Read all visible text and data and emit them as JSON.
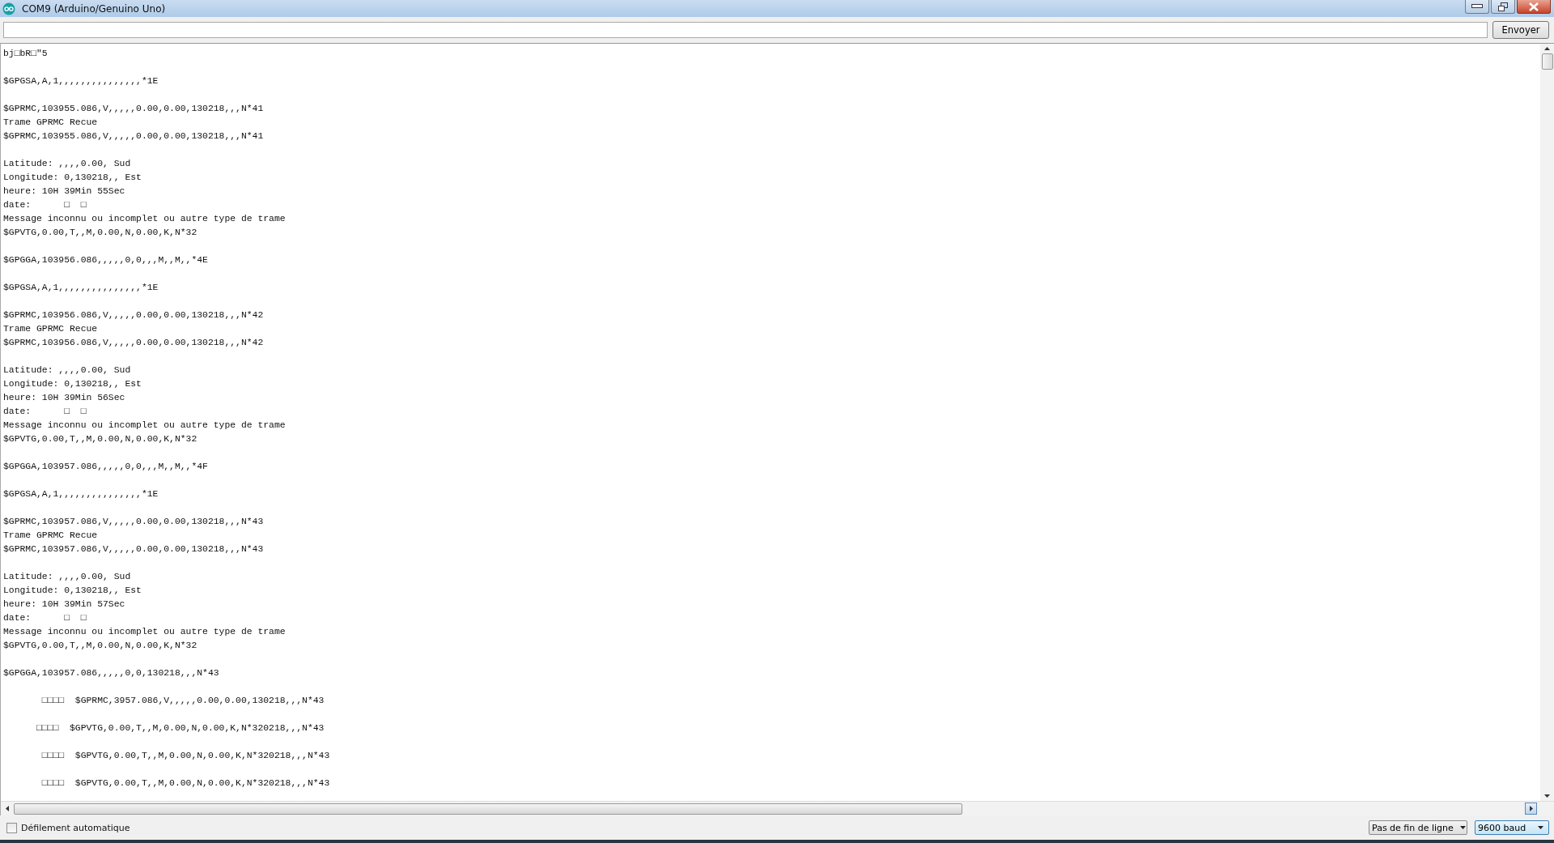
{
  "window": {
    "title": "COM9 (Arduino/Genuino Uno)"
  },
  "send_button": "Envoyer",
  "output": [
    [
      "bj□bR□\"5"
    ],
    [
      "$GPGSA,A,1,,,,,,,,,,,,,,,*1E"
    ],
    [
      "$GPRMC,103955.086,V,,,,,0.00,0.00,130218,,,N*41",
      "Trame GPRMC Recue",
      "$GPRMC,103955.086,V,,,,,0.00,0.00,130218,,,N*41"
    ],
    [
      "Latitude: ,,,,0.00, Sud",
      "Longitude: 0,130218,, Est",
      "heure: 10H 39Min 55Sec",
      "date:      □  □",
      "Message inconnu ou incomplet ou autre type de trame",
      "$GPVTG,0.00,T,,M,0.00,N,0.00,K,N*32"
    ],
    [
      "$GPGGA,103956.086,,,,,0,0,,,M,,M,,*4E"
    ],
    [
      "$GPGSA,A,1,,,,,,,,,,,,,,,*1E"
    ],
    [
      "$GPRMC,103956.086,V,,,,,0.00,0.00,130218,,,N*42",
      "Trame GPRMC Recue",
      "$GPRMC,103956.086,V,,,,,0.00,0.00,130218,,,N*42"
    ],
    [
      "Latitude: ,,,,0.00, Sud",
      "Longitude: 0,130218,, Est",
      "heure: 10H 39Min 56Sec",
      "date:      □  □",
      "Message inconnu ou incomplet ou autre type de trame",
      "$GPVTG,0.00,T,,M,0.00,N,0.00,K,N*32"
    ],
    [
      "$GPGGA,103957.086,,,,,0,0,,,M,,M,,*4F"
    ],
    [
      "$GPGSA,A,1,,,,,,,,,,,,,,,*1E"
    ],
    [
      "$GPRMC,103957.086,V,,,,,0.00,0.00,130218,,,N*43",
      "Trame GPRMC Recue",
      "$GPRMC,103957.086,V,,,,,0.00,0.00,130218,,,N*43"
    ],
    [
      "Latitude: ,,,,0.00, Sud",
      "Longitude: 0,130218,, Est",
      "heure: 10H 39Min 57Sec",
      "date:      □  □",
      "Message inconnu ou incomplet ou autre type de trame",
      "$GPVTG,0.00,T,,M,0.00,N,0.00,K,N*32"
    ],
    [
      "$GPGGA,103957.086,,,,,0,0,130218,,,N*43"
    ],
    [
      "       □□□□  $GPRMC,3957.086,V,,,,,0.00,0.00,130218,,,N*43"
    ],
    [
      "      □□□□  $GPVTG,0.00,T,,M,0.00,N,0.00,K,N*320218,,,N*43"
    ],
    [
      "       □□□□  $GPVTG,0.00,T,,M,0.00,N,0.00,K,N*320218,,,N*43"
    ],
    [
      "       □□□□  $GPVTG,0.00,T,,M,0.00,N,0.00,K,N*320218,,,N*43"
    ]
  ],
  "autoscroll": {
    "label": "Défilement automatique",
    "checked": false
  },
  "line_ending": {
    "value": "Pas de fin de ligne",
    "selected": false
  },
  "baud_rate": {
    "value": "9600 baud",
    "selected": true
  }
}
